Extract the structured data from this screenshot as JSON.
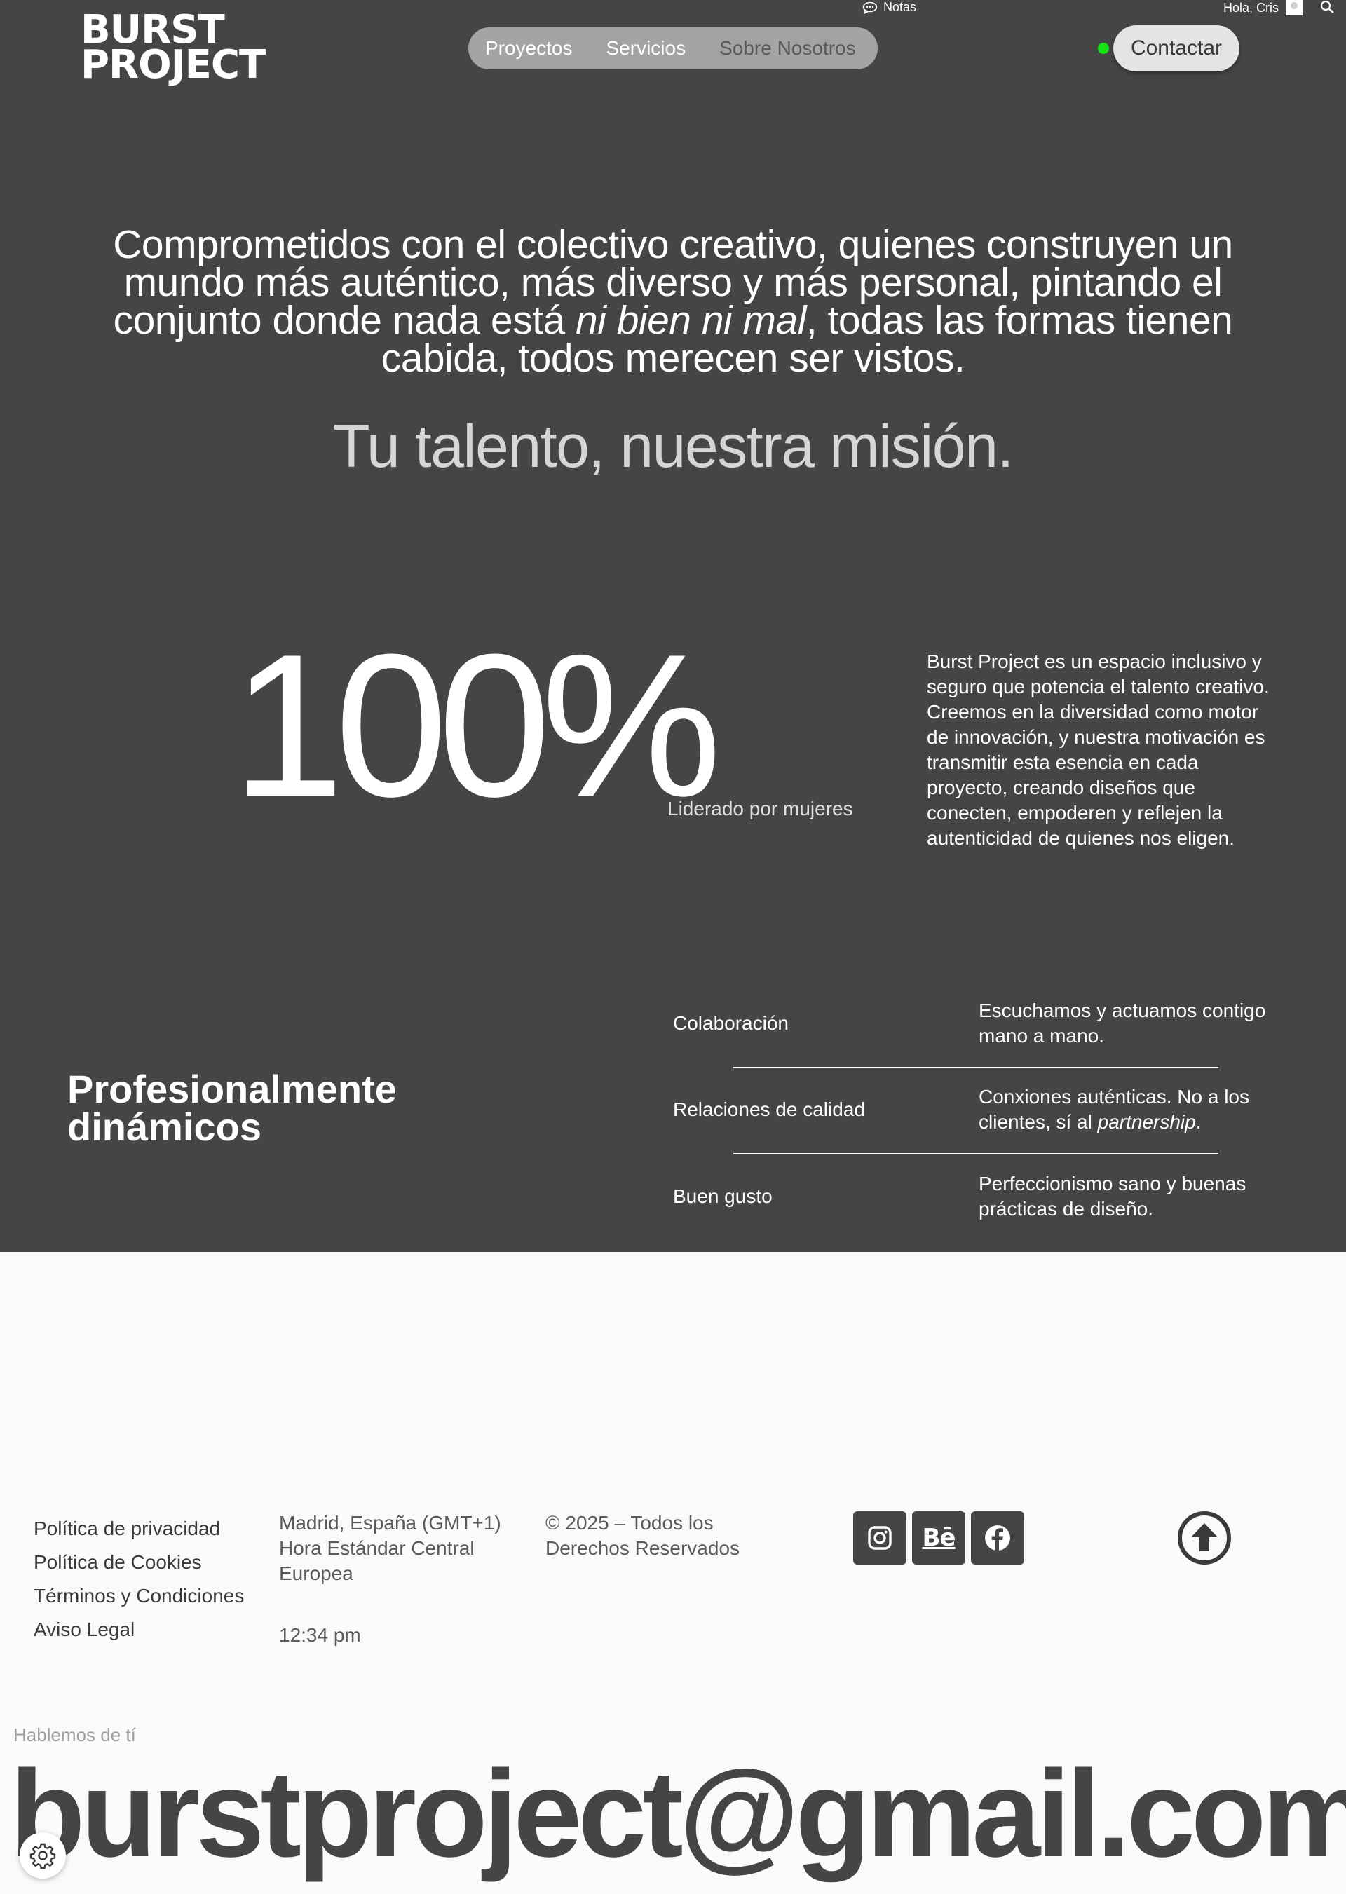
{
  "header": {
    "logo_line1": "BURST",
    "logo_line2": "PROJECT",
    "notes_label": "Notas",
    "greeting": "Hola, Cris",
    "nav": [
      {
        "label": "Proyectos"
      },
      {
        "label": "Servicios"
      },
      {
        "label": "Sobre Nosotros"
      }
    ],
    "contact_label": "Contactar",
    "status_color": "#14e314"
  },
  "hero": {
    "statement_part1": "Comprometidos con el colectivo creativo, quienes construyen un mundo más auténtico, más diverso y más personal, pintando el conjunto donde nada está ",
    "statement_italic": "ni bien ni mal",
    "statement_part2": ", todas las formas tienen cabida, todos merecen ser vistos.",
    "mission": "Tu talento, nuestra misión."
  },
  "stats": {
    "percent": "100%",
    "percent_label": "Liderado por mujeres",
    "about_brand": "Burst Project",
    "about_text": " es un espacio inclusivo y seguro que potencia el talento creativo. Creemos en la diversidad como motor de innovación, y nuestra motivación es transmitir esta esencia en cada proyecto, creando diseños que conecten, empoderen y reflejen la autenticidad de quienes nos eligen."
  },
  "values": {
    "title": "Profesionalmente dinámicos",
    "items": [
      {
        "name": "Colaboración",
        "desc": "Escuchamos y actuamos contigo mano a mano.",
        "desc_italic": ""
      },
      {
        "name": "Relaciones de calidad",
        "desc": "Conxiones auténticas. No a los clientes, sí al ",
        "desc_italic": "partnership",
        "desc_end": "."
      },
      {
        "name": "Buen gusto",
        "desc": "Perfeccionismo sano y buenas prácticas de diseño.",
        "desc_italic": ""
      }
    ]
  },
  "footer": {
    "legal": [
      "Política de privacidad",
      "Política de Cookies",
      "Términos y Condiciones",
      "Aviso Legal"
    ],
    "location": "Madrid, España (GMT+1) Hora Estándar Central Europea",
    "time": "12:34 pm",
    "copyright": "© 2025 – Todos los Derechos Reservados",
    "socials": [
      {
        "icon": "instagram-icon"
      },
      {
        "icon": "behance-icon",
        "text": "Bē"
      },
      {
        "icon": "facebook-icon"
      }
    ],
    "talk_label": "Hablemos de tí",
    "email": "burstproject@gmail.com"
  },
  "colors": {
    "dark_bg": "#454545",
    "light_bg": "#fafafa",
    "nav_pill": "#a3a3a3"
  }
}
